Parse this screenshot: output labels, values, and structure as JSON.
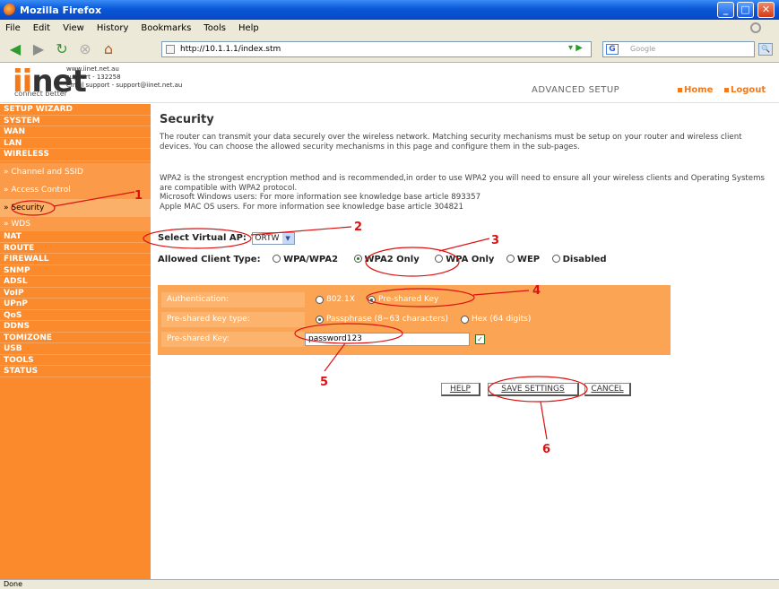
{
  "window": {
    "title": "Mozilla Firefox"
  },
  "menu": [
    "File",
    "Edit",
    "View",
    "History",
    "Bookmarks",
    "Tools",
    "Help"
  ],
  "toolbar": {
    "url": "http://10.1.1.1/index.stm",
    "search_placeholder": "Google",
    "search_engine_icon": "G"
  },
  "banner": {
    "logo": "iinet",
    "tagline": "connect better",
    "website": "www.iinet.net.au",
    "support_phone": "support - 132258",
    "support_email": "email support - support@iinet.net.au",
    "section": "ADVANCED SETUP",
    "home": "Home",
    "logout": "Logout"
  },
  "sidebar": {
    "items": [
      {
        "label": "SETUP WIZARD"
      },
      {
        "label": "SYSTEM"
      },
      {
        "label": "WAN"
      },
      {
        "label": "LAN"
      },
      {
        "label": "WIRELESS"
      }
    ],
    "wireless_subitems": [
      {
        "label": "» Channel and SSID"
      },
      {
        "label": "» Access Control"
      },
      {
        "label": "» Security"
      },
      {
        "label": "» WDS"
      }
    ],
    "items_after": [
      {
        "label": "NAT"
      },
      {
        "label": "ROUTE"
      },
      {
        "label": "FIREWALL"
      },
      {
        "label": "SNMP"
      },
      {
        "label": "ADSL"
      },
      {
        "label": "VoIP"
      },
      {
        "label": "UPnP"
      },
      {
        "label": "QoS"
      },
      {
        "label": "DDNS"
      },
      {
        "label": "TOMIZONE"
      },
      {
        "label": "USB"
      },
      {
        "label": "TOOLS"
      },
      {
        "label": "STATUS"
      }
    ]
  },
  "main": {
    "title": "Security",
    "intro": "The router can transmit your data securely over the wireless network. Matching security mechanisms must be setup on your router and wireless client devices. You can choose the allowed security mechanisms in this page and configure them in the sub-pages.",
    "wpa2_note_1": "WPA2 is the strongest encryption method and is recommended,in order to use WPA2 you will need to ensure all your wireless clients and Operating Systems are compatible with WPA2 protocol.",
    "wpa2_note_2": "Microsoft Windows users: For more information see knowledge base article 893357",
    "wpa2_note_3": "Apple MAC OS users. For more information see knowledge base article 304821",
    "virtual_ap_label": "Select Virtual AP:",
    "virtual_ap_value": "ORTW",
    "client_type_label": "Allowed Client Type:",
    "client_types": [
      {
        "label": "WPA/WPA2",
        "selected": false
      },
      {
        "label": "WPA2 Only",
        "selected": true
      },
      {
        "label": "WPA Only",
        "selected": false
      },
      {
        "label": "WEP",
        "selected": false
      },
      {
        "label": "Disabled",
        "selected": false
      }
    ],
    "auth_label": "Authentication:",
    "auth_options": [
      {
        "label": "802.1X",
        "selected": false
      },
      {
        "label": "Pre-shared Key",
        "selected": true
      }
    ],
    "psk_type_label": "Pre-shared key type:",
    "psk_type_options": [
      {
        "label": "Passphrase (8~63 characters)",
        "selected": true
      },
      {
        "label": "Hex (64 digits)",
        "selected": false
      }
    ],
    "psk_label": "Pre-shared Key:",
    "psk_value": "password123",
    "help_button": "HELP",
    "save_button": "SAVE SETTINGS",
    "cancel_button": "CANCEL"
  },
  "annotations": [
    "1",
    "2",
    "3",
    "4",
    "5",
    "6"
  ],
  "status": "Done",
  "colors": {
    "sidebar": "#fb8a2c",
    "accent": "#f07a1e",
    "annotation": "#dd1111",
    "table": "#fba454"
  }
}
